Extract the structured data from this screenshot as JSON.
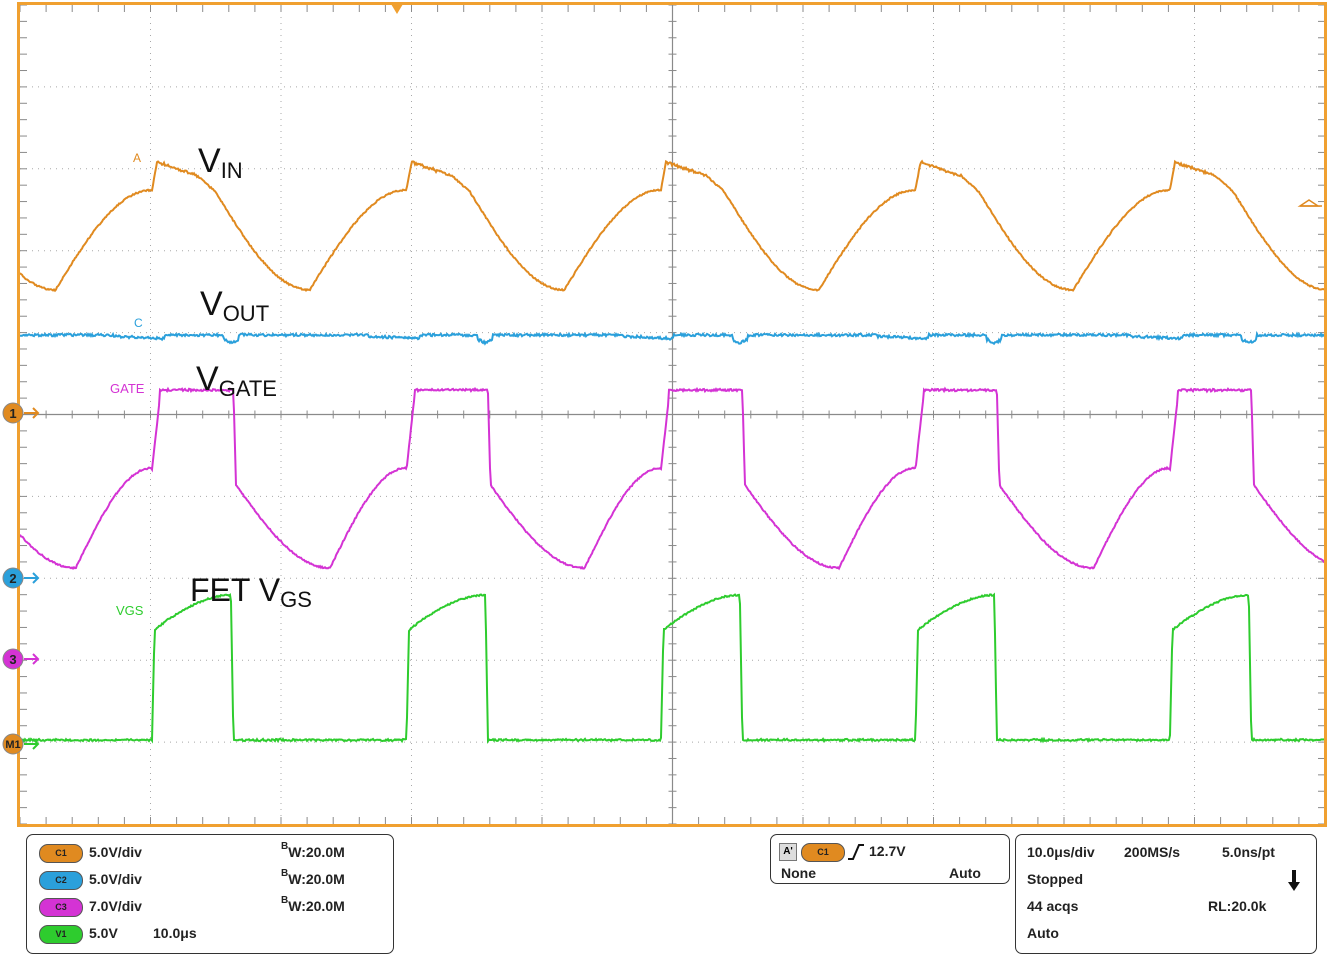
{
  "colors": {
    "frame": "#f0a030",
    "ch1": "#e08a20",
    "ch2": "#2ba0db",
    "ch3": "#d433d4",
    "ch4": "#2ecc2e",
    "grid": "#a8a8a8"
  },
  "waveforms": {
    "period_divisions": 1.95,
    "cycles_visible": 10,
    "ch1": {
      "label": "A",
      "annotation": "V",
      "annotation_sub": "IN"
    },
    "ch2": {
      "label": "C",
      "annotation": "V",
      "annotation_sub": "OUT"
    },
    "ch3": {
      "label": "GATE",
      "annotation": "V",
      "annotation_sub": "GATE"
    },
    "ch4": {
      "label": "VGS",
      "annotation": "FET V",
      "annotation_sub": "GS"
    }
  },
  "markers": {
    "m1": "1",
    "m2": "2",
    "m3": "3",
    "m4": "M1"
  },
  "panel_channels": {
    "c1": {
      "badge": "C1",
      "scale": "5.0V/div",
      "bw": "W:20.0M"
    },
    "c2": {
      "badge": "C2",
      "scale": "5.0V/div",
      "bw": "W:20.0M"
    },
    "c3": {
      "badge": "C3",
      "scale": "7.0V/div",
      "bw": "W:20.0M"
    },
    "v1": {
      "badge": "V1",
      "scale": "5.0V",
      "time": "10.0μs"
    }
  },
  "bw_prefix": "B",
  "trigger": {
    "badge_a": "A'",
    "badge_src": "C1",
    "level": "12.7V",
    "coupling": "None",
    "mode": "Auto"
  },
  "acquisition": {
    "timebase": "10.0μs/div",
    "sample_rate": "200MS/s",
    "resolution": "5.0ns/pt",
    "state": "Stopped",
    "acqs": "44 acqs",
    "record_length": "RL:20.0k",
    "mode": "Auto"
  }
}
